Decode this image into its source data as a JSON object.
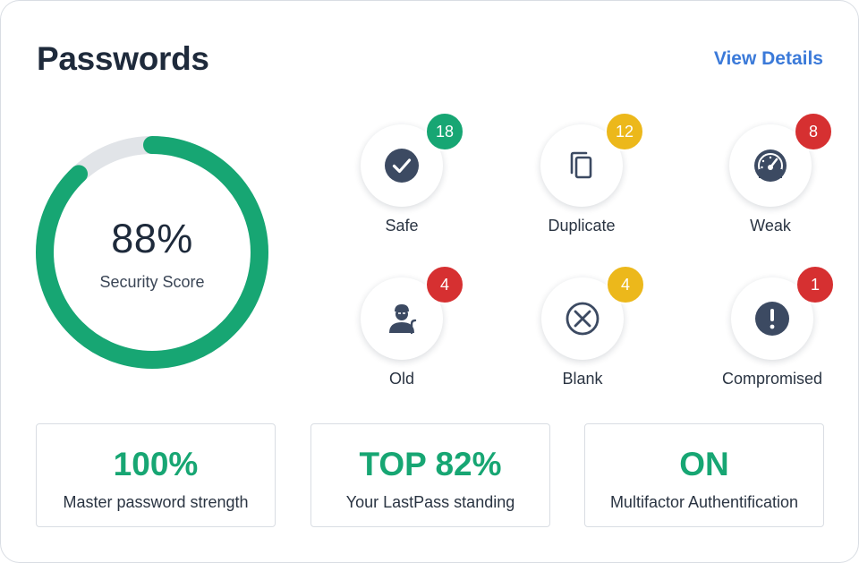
{
  "header": {
    "title": "Passwords",
    "link": "View Details"
  },
  "score": {
    "value": "88%",
    "label": "Security Score",
    "fraction": 0.88
  },
  "colors": {
    "accent_green": "#17a673",
    "link_blue": "#3b7ad9",
    "badge_yellow": "#ecb81b",
    "badge_red": "#d63031",
    "icon_navy": "#3c4a62",
    "track_gray": "#e1e4e8"
  },
  "stats": [
    {
      "label": "Safe",
      "count": "18",
      "icon": "check-circle-icon",
      "badge": "green"
    },
    {
      "label": "Duplicate",
      "count": "12",
      "icon": "copy-icon",
      "badge": "yellow"
    },
    {
      "label": "Weak",
      "count": "8",
      "icon": "speedometer-icon",
      "badge": "red"
    },
    {
      "label": "Old",
      "count": "4",
      "icon": "old-person-icon",
      "badge": "red"
    },
    {
      "label": "Blank",
      "count": "4",
      "icon": "circle-x-icon",
      "badge": "yellow"
    },
    {
      "label": "Compromised",
      "count": "1",
      "icon": "exclamation-circle-icon",
      "badge": "red"
    }
  ],
  "tiles": [
    {
      "value": "100%",
      "label": "Master password strength"
    },
    {
      "value": "TOP 82%",
      "label": "Your LastPass standing"
    },
    {
      "value": "ON",
      "label": "Multifactor Authentification"
    }
  ]
}
